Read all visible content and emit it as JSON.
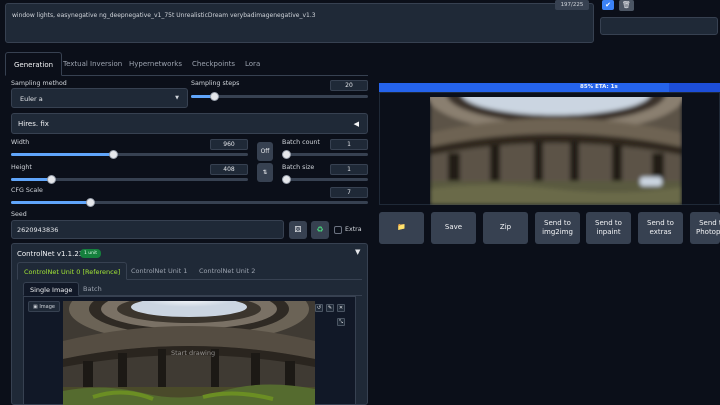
{
  "prompt": {
    "text": "window lights, easynegative ng_deepnegative_v1_75t UnrealisticDream verybadimagenegative_v1.3",
    "token_count": "197/225"
  },
  "icons": {
    "check": "check-icon",
    "trash": "trash-icon"
  },
  "tabs": [
    "Generation",
    "Textual Inversion",
    "Hypernetworks",
    "Checkpoints",
    "Lora"
  ],
  "sampling": {
    "method_label": "Sampling method",
    "method_value": "Euler a",
    "steps_label": "Sampling steps",
    "steps_value": "20",
    "steps_fraction": 0.13
  },
  "hires": {
    "label": "Hires. fix"
  },
  "size": {
    "width_label": "Width",
    "width_value": "960",
    "width_fraction": 0.43,
    "height_label": "Height",
    "height_value": "408",
    "height_fraction": 0.17,
    "swap_label": "Off"
  },
  "batch": {
    "count_label": "Batch count",
    "count_value": "1",
    "size_label": "Batch size",
    "size_value": "1"
  },
  "cfg": {
    "label": "CFG Scale",
    "value": "7",
    "fraction": 0.22
  },
  "seed": {
    "label": "Seed",
    "value": "2620943836",
    "extra_label": "Extra"
  },
  "controlnet": {
    "title": "ControlNet v1.1.234",
    "badge": "1 unit",
    "units": [
      "ControlNet Unit 0 [Reference]",
      "ControlNet Unit 1",
      "ControlNet Unit 2"
    ],
    "image_tabs": [
      "Single Image",
      "Batch"
    ],
    "image_label": "Image",
    "hint": "Start drawing"
  },
  "progress": {
    "text": "85% ETA: 1s",
    "fraction": 0.85
  },
  "actions": [
    "Zip",
    "Send to img2img",
    "Send to inpaint",
    "Send to extras",
    "Send to Photopea"
  ],
  "save_label": "Save",
  "colors": {
    "accent": "#2563eb",
    "unit_active": "#a3e635",
    "badge": "#15803d"
  }
}
